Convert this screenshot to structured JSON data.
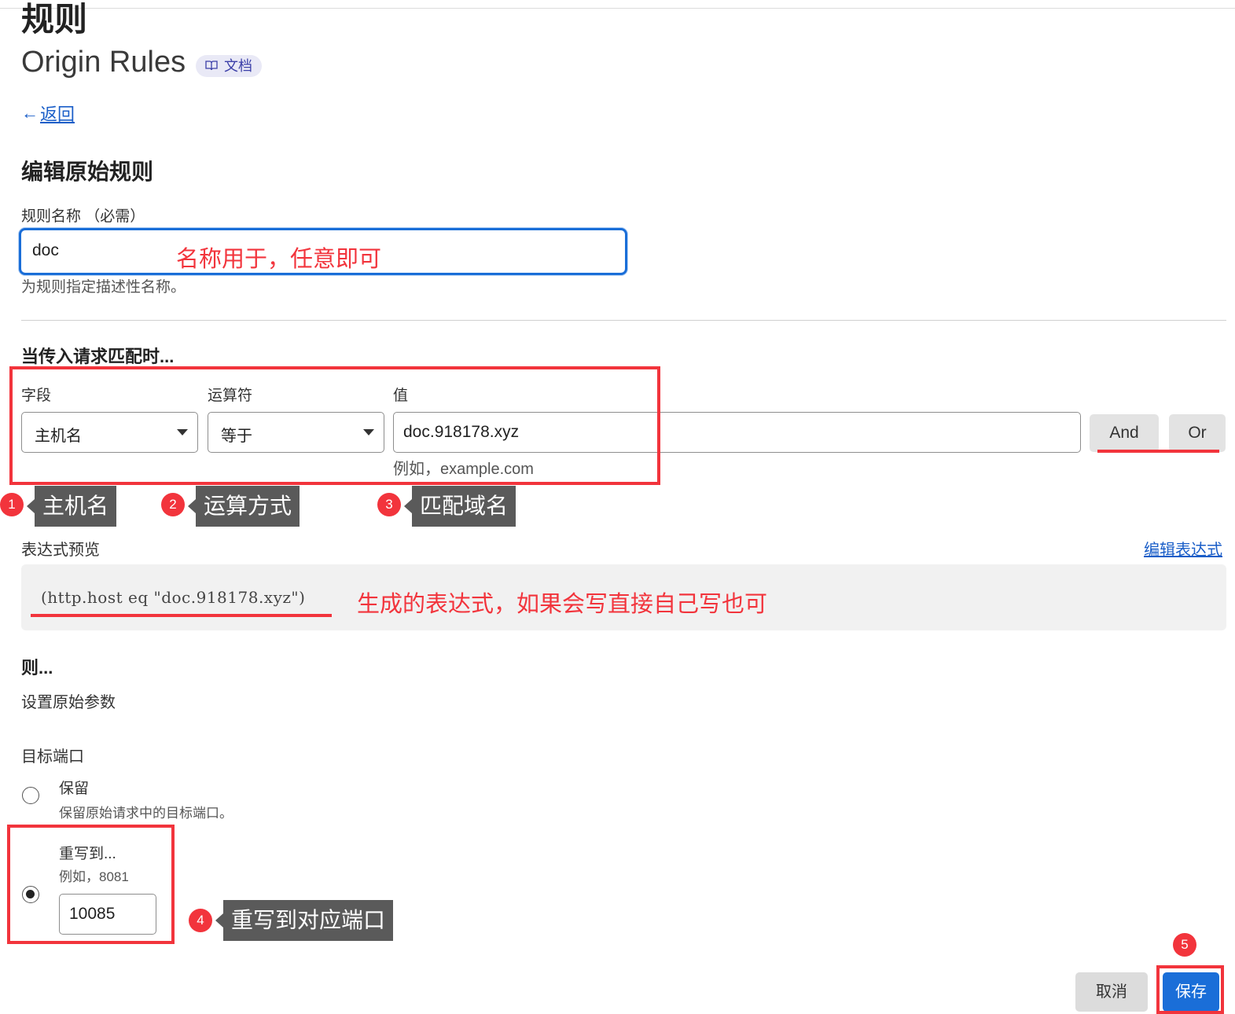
{
  "header": {
    "title": "规则",
    "subtitle": "Origin Rules",
    "docs_badge": "文档",
    "back_arrow": "←",
    "back_label": "返回"
  },
  "form": {
    "section_title": "编辑原始规则",
    "rule_name_label": "规则名称 （必需）",
    "rule_name_value": "doc",
    "rule_name_help": "为规则指定描述性名称。"
  },
  "match": {
    "title": "当传入请求匹配时...",
    "field_label": "字段",
    "operator_label": "运算符",
    "value_label": "值",
    "field_value": "主机名",
    "operator_value": "等于",
    "value_input": "doc.918178.xyz",
    "value_help": "例如，example.com",
    "and_label": "And",
    "or_label": "Or"
  },
  "expression": {
    "label": "表达式预览",
    "edit_link": "编辑表达式",
    "text": "(http.host eq \"doc.918178.xyz\")"
  },
  "then": {
    "title": "则...",
    "subtitle": "设置原始参数",
    "port_label": "目标端口",
    "options": [
      {
        "label": "保留",
        "desc": "保留原始请求中的目标端口。",
        "selected": false
      },
      {
        "label": "重写到...",
        "desc": "例如，8081",
        "selected": true
      }
    ],
    "port_value": "10085"
  },
  "actions": {
    "cancel": "取消",
    "save": "保存"
  },
  "annotations": {
    "name_note": "名称用于，任意即可",
    "expr_note": "生成的表达式，如果会写直接自己写也可",
    "tips": [
      {
        "num": "1",
        "text": "主机名"
      },
      {
        "num": "2",
        "text": "运算方式"
      },
      {
        "num": "3",
        "text": "匹配域名"
      },
      {
        "num": "4",
        "text": "重写到对应端口"
      },
      {
        "num": "5",
        "text": ""
      }
    ],
    "accent_color": "#f2343c"
  },
  "colors": {
    "primary": "#1a6ed8",
    "link": "#1a5ec8",
    "doc_badge_bg": "#e9e9f6"
  }
}
